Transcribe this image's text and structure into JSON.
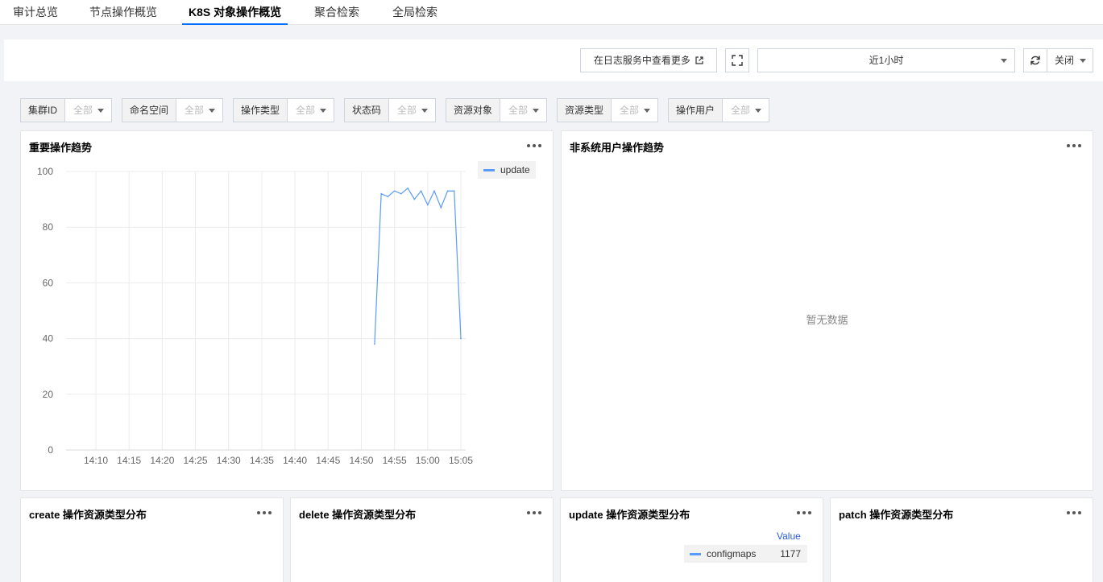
{
  "tabs": [
    {
      "label": "审计总览"
    },
    {
      "label": "节点操作概览"
    },
    {
      "label": "K8S 对象操作概览",
      "active": true
    },
    {
      "label": "聚合检索"
    },
    {
      "label": "全局检索"
    }
  ],
  "toolbar": {
    "view_more_label": "在日志服务中查看更多",
    "time_range": "近1小时",
    "auto_refresh": "关闭"
  },
  "filters": [
    {
      "label": "集群ID",
      "value": "全部"
    },
    {
      "label": "命名空间",
      "value": "全部"
    },
    {
      "label": "操作类型",
      "value": "全部"
    },
    {
      "label": "状态码",
      "value": "全部"
    },
    {
      "label": "资源对象",
      "value": "全部"
    },
    {
      "label": "资源类型",
      "value": "全部"
    },
    {
      "label": "操作用户",
      "value": "全部"
    }
  ],
  "panels": {
    "important_trend": {
      "title": "重要操作趋势"
    },
    "non_system_trend": {
      "title": "非系统用户操作趋势",
      "empty_text": "暂无数据"
    },
    "create_dist": {
      "title": "create 操作资源类型分布"
    },
    "delete_dist": {
      "title": "delete 操作资源类型分布"
    },
    "update_dist": {
      "title": "update 操作资源类型分布",
      "value_header": "Value",
      "items": [
        {
          "name": "configmaps",
          "value": "1177"
        }
      ]
    },
    "patch_dist": {
      "title": "patch 操作资源类型分布"
    }
  },
  "colors": {
    "accent": "#006eff",
    "series": "#5b9bf8"
  },
  "chart_data": {
    "type": "line",
    "title": "重要操作趋势",
    "x_ticks": [
      "14:10",
      "14:15",
      "14:20",
      "14:25",
      "14:30",
      "14:35",
      "14:40",
      "14:45",
      "14:50",
      "14:55",
      "15:00",
      "15:05"
    ],
    "y_ticks": [
      "0",
      "20",
      "40",
      "60",
      "80",
      "100"
    ],
    "ylim": [
      0,
      100
    ],
    "grid": true,
    "legend": "top-right",
    "series": [
      {
        "name": "update",
        "x": [
          "14:52",
          "14:53",
          "14:54",
          "14:55",
          "14:56",
          "14:57",
          "14:58",
          "14:59",
          "15:00",
          "15:01",
          "15:02",
          "15:03",
          "15:04",
          "15:05"
        ],
        "values": [
          38,
          92,
          91,
          93,
          92,
          94,
          90,
          93,
          88,
          93,
          87,
          93,
          93,
          40
        ]
      }
    ]
  }
}
